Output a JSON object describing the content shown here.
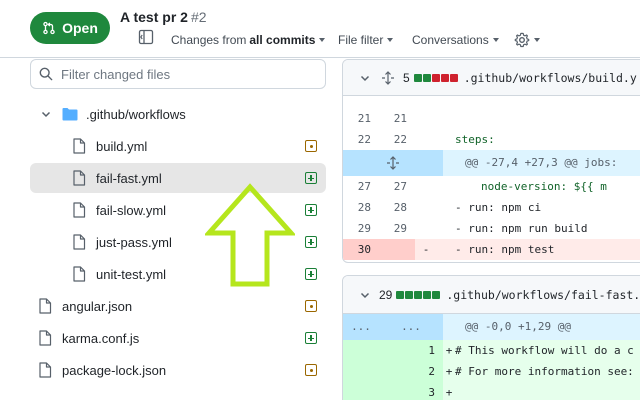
{
  "header": {
    "status_label": "Open",
    "title": "A test pr 2",
    "number": "#2",
    "changes_prefix": "Changes from",
    "changes_value": "all commits",
    "file_filter": "File filter",
    "conversations": "Conversations"
  },
  "tree": {
    "search_placeholder": "Filter changed files",
    "folder": ".github/workflows",
    "items": [
      {
        "label": "build.yml",
        "status": "modified"
      },
      {
        "label": "fail-fast.yml",
        "status": "added",
        "selected": true
      },
      {
        "label": "fail-slow.yml",
        "status": "added"
      },
      {
        "label": "just-pass.yml",
        "status": "added"
      },
      {
        "label": "unit-test.yml",
        "status": "added"
      },
      {
        "label": "angular.json",
        "status": "modified"
      },
      {
        "label": "karma.conf.js",
        "status": "added"
      },
      {
        "label": "package-lock.json",
        "status": "modified"
      }
    ]
  },
  "diff1": {
    "count": "5",
    "path": ".github/workflows/build.y",
    "rows": [
      {
        "old": "21",
        "new": "21",
        "sign": "",
        "code": ""
      },
      {
        "old": "22",
        "new": "22",
        "sign": "",
        "code": "steps:"
      },
      {
        "hunk": "@@ -27,4 +27,3 @@ jobs:"
      },
      {
        "old": "27",
        "new": "27",
        "sign": "",
        "code": "node-version: ${{ m"
      },
      {
        "old": "28",
        "new": "28",
        "sign": "",
        "code": "- run: npm ci"
      },
      {
        "old": "29",
        "new": "29",
        "sign": "",
        "code": "- run: npm run build"
      },
      {
        "old": "30",
        "new": "",
        "sign": "-",
        "code": "- run: npm test"
      }
    ]
  },
  "diff2": {
    "count": "29",
    "path": ".github/workflows/fail-fast.",
    "hunk_dots": "...",
    "hunk": "@@ -0,0 +1,29 @@",
    "rows": [
      {
        "new": "1",
        "sign": "+",
        "code": "# This workflow will do a c"
      },
      {
        "new": "2",
        "sign": "+",
        "code": "# For more information see:"
      },
      {
        "new": "3",
        "sign": "+",
        "code": ""
      }
    ]
  },
  "colors": {
    "open_green": "#1f883d",
    "added": "#1a7f37",
    "modified": "#9a6700",
    "arrow": "#b5e61d"
  }
}
